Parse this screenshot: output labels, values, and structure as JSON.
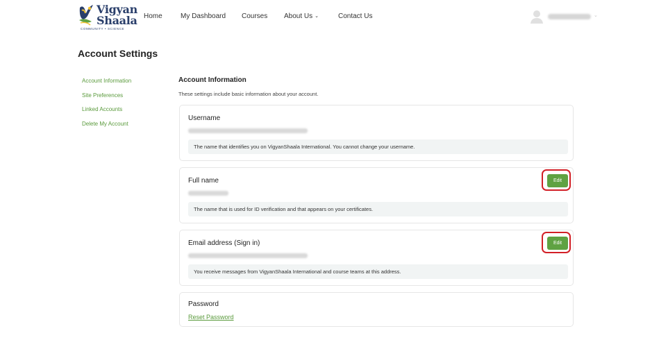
{
  "header": {
    "logo": {
      "line1": "Vigyan",
      "line2": "Shaala",
      "tagline": "COMMUNITY • SCIENCE"
    },
    "nav": [
      {
        "label": "Home"
      },
      {
        "label": "My Dashboard"
      },
      {
        "label": "Courses"
      },
      {
        "label": "About Us"
      },
      {
        "label": "Contact Us"
      }
    ],
    "about_chevron": "⌄",
    "user": {
      "avatar_icon": "user-avatar-icon",
      "chevron": "⌄"
    }
  },
  "page": {
    "title": "Account Settings"
  },
  "sidebar": {
    "items": [
      {
        "label": "Account Information"
      },
      {
        "label": "Site Preferences"
      },
      {
        "label": "Linked Accounts"
      },
      {
        "label": "Delete My Account"
      }
    ]
  },
  "section": {
    "title": "Account Information",
    "description": "These settings include basic information about your account."
  },
  "fields": {
    "username": {
      "label": "Username",
      "hint": "The name that identifies you on VigyanShaala International. You cannot change your username."
    },
    "full_name": {
      "label": "Full name",
      "edit_label": "Edit",
      "hint": "The name that is used for ID verification and that appears on your certificates."
    },
    "email": {
      "label": "Email address (Sign in)",
      "edit_label": "Edit",
      "hint": "You receive messages from VigyanShaala International and course teams at this address."
    },
    "password": {
      "label": "Password",
      "reset_label": "Reset Password"
    }
  },
  "colors": {
    "accent_green": "#5fa242",
    "link_green": "#5a9a3c",
    "highlight_red": "#d21f26",
    "brand_navy": "#2a3f6b"
  }
}
